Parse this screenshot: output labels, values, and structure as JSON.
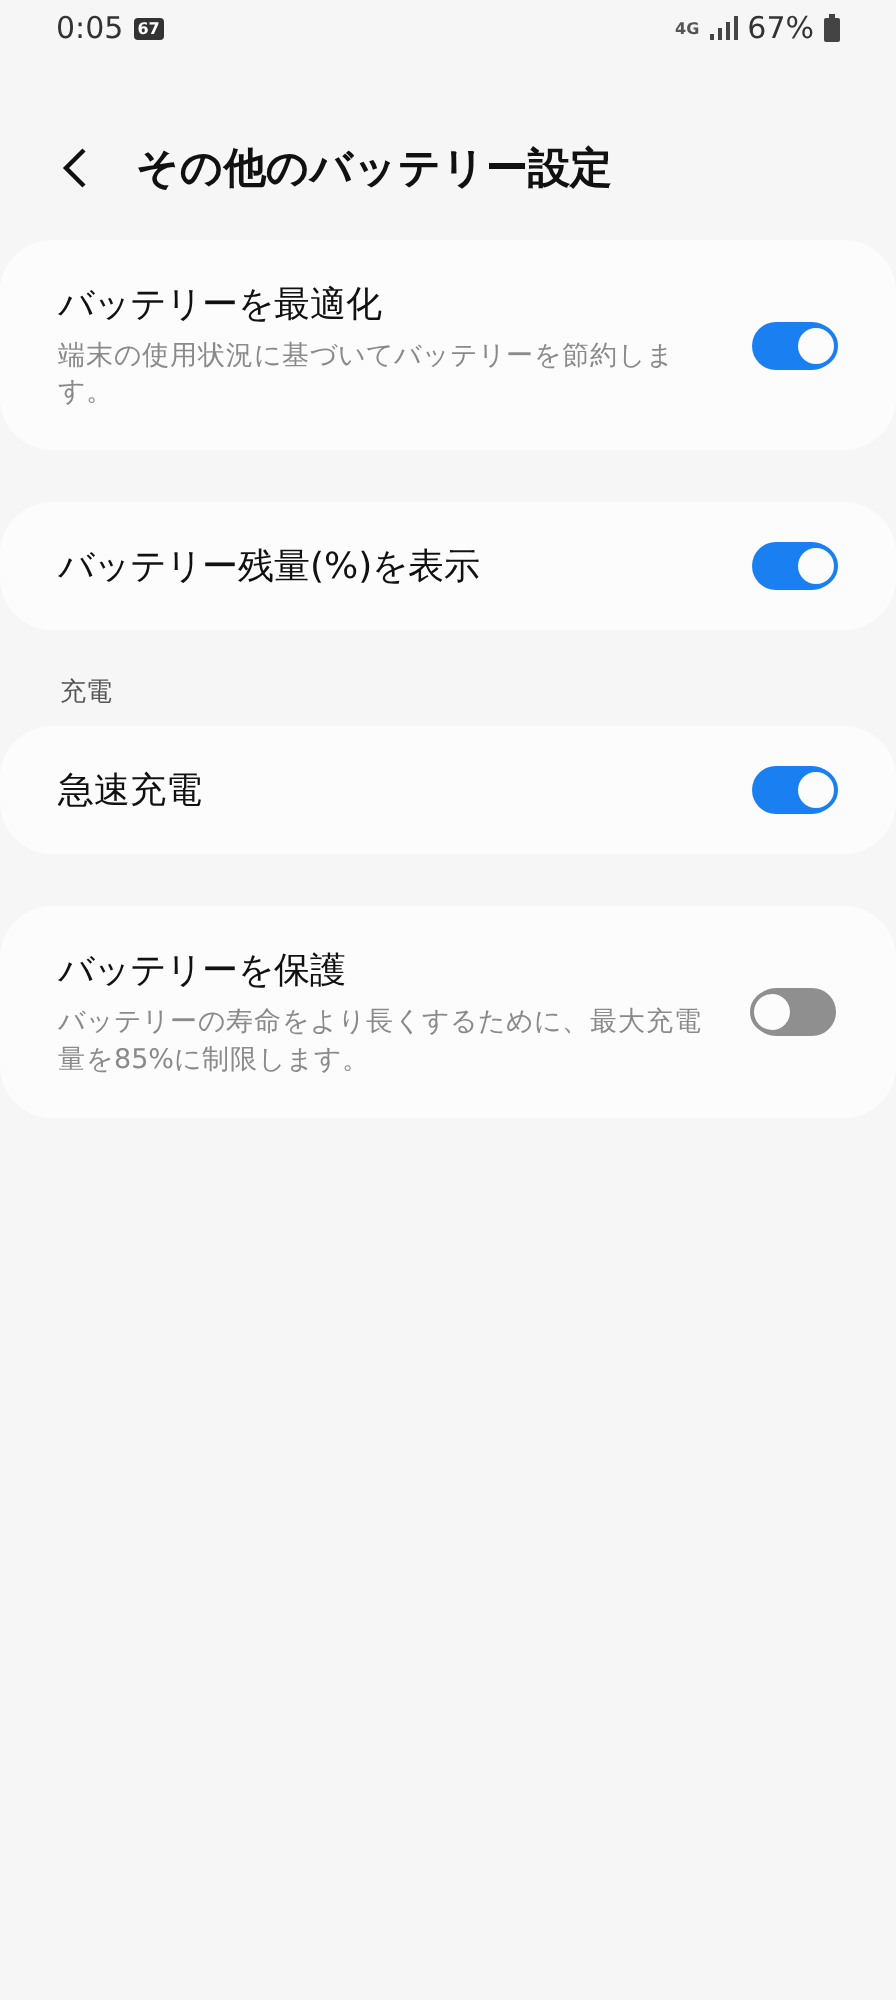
{
  "status_bar": {
    "time": "0:05",
    "notification_badge": "67",
    "network": "4G",
    "battery": "67%"
  },
  "header": {
    "title": "その他のバッテリー設定"
  },
  "sections": [
    {
      "items": [
        {
          "title": "バッテリーを最適化",
          "description": "端末の使用状況に基づいてバッテリーを節約します。",
          "on": true
        }
      ]
    },
    {
      "items": [
        {
          "title": "バッテリー残量(%)を表示",
          "on": true
        }
      ]
    },
    {
      "label": "充電",
      "items": [
        {
          "title": "急速充電",
          "on": true
        }
      ]
    },
    {
      "items": [
        {
          "title": "バッテリーを保護",
          "description": "バッテリーの寿命をより長くするために、最大充電量を85%に制限します。",
          "on": false
        }
      ]
    }
  ]
}
